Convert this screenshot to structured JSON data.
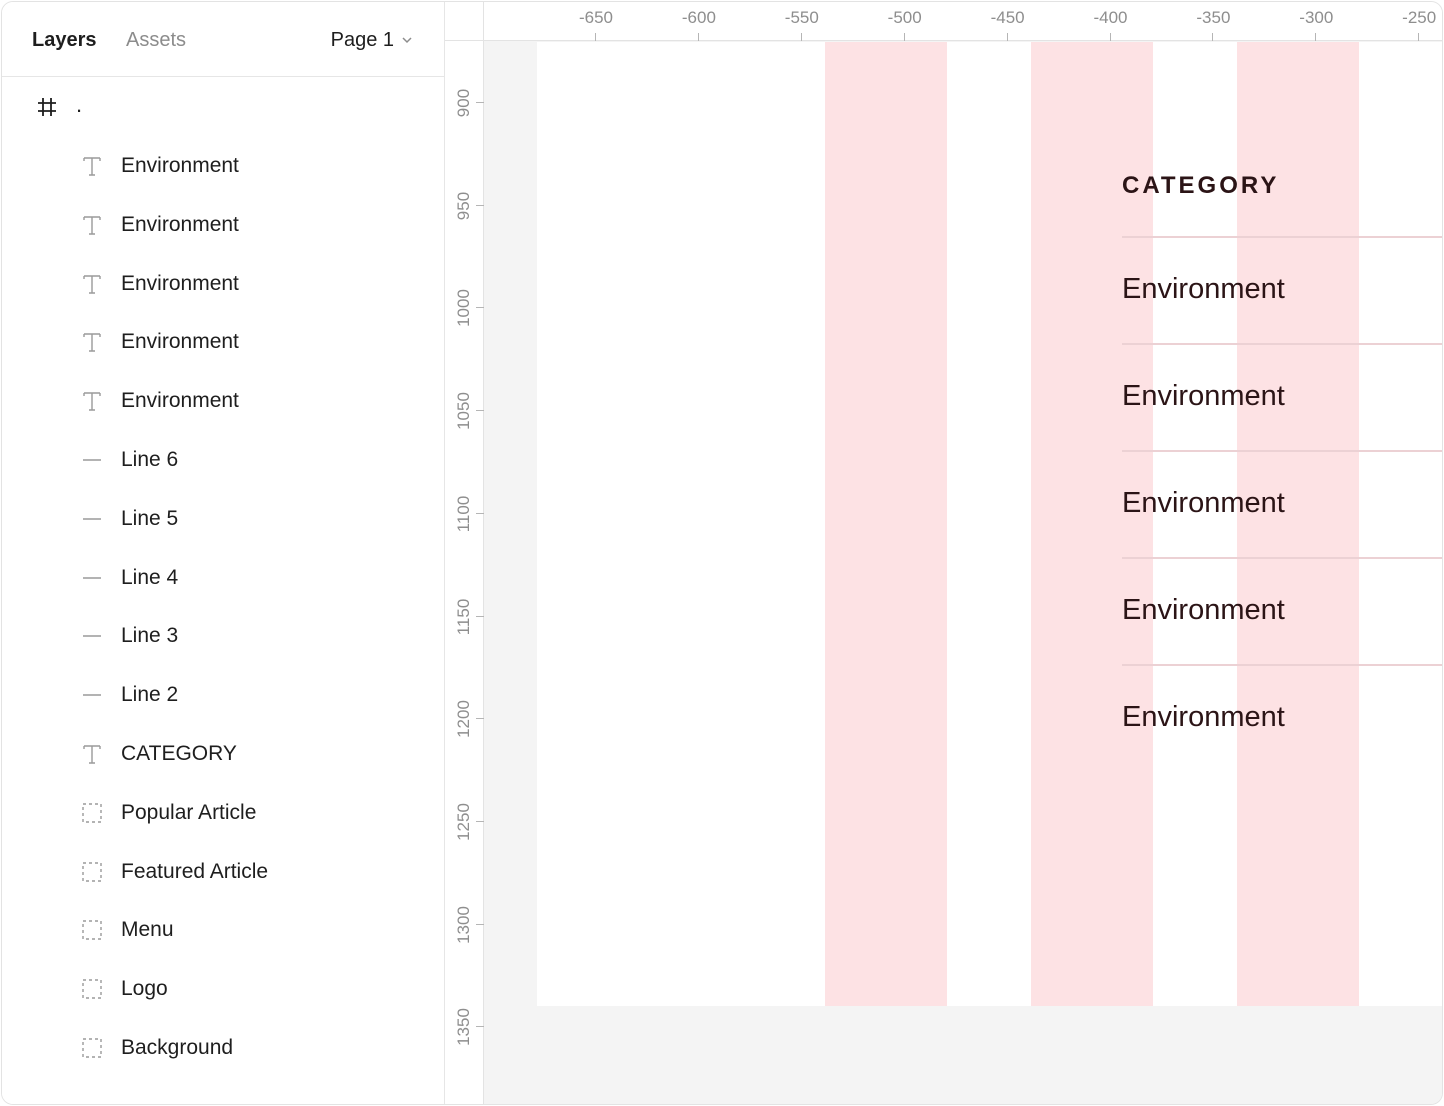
{
  "sidebar": {
    "tabs": {
      "layers": "Layers",
      "assets": "Assets"
    },
    "page": "Page 1",
    "frame": {
      "name": ".",
      "icon": "frame-hash-icon"
    },
    "layers": [
      {
        "label": "Environment",
        "icon": "text-icon"
      },
      {
        "label": "Environment",
        "icon": "text-icon"
      },
      {
        "label": "Environment",
        "icon": "text-icon"
      },
      {
        "label": "Environment",
        "icon": "text-icon"
      },
      {
        "label": "Environment",
        "icon": "text-icon"
      },
      {
        "label": "Line 6",
        "icon": "line-icon"
      },
      {
        "label": "Line 5",
        "icon": "line-icon"
      },
      {
        "label": "Line 4",
        "icon": "line-icon"
      },
      {
        "label": "Line 3",
        "icon": "line-icon"
      },
      {
        "label": "Line 2",
        "icon": "line-icon"
      },
      {
        "label": "CATEGORY",
        "icon": "text-icon"
      },
      {
        "label": "Popular Article",
        "icon": "group-icon"
      },
      {
        "label": "Featured Article",
        "icon": "group-icon"
      },
      {
        "label": "Menu",
        "icon": "group-icon"
      },
      {
        "label": "Logo",
        "icon": "group-icon"
      },
      {
        "label": "Background",
        "icon": "group-icon"
      }
    ]
  },
  "rulers": {
    "horizontal": [
      "-650",
      "-600",
      "-550",
      "-500",
      "-450",
      "-400",
      "-350",
      "-300",
      "-250"
    ],
    "vertical": [
      "900",
      "950",
      "1000",
      "1050",
      "1100",
      "1150",
      "1200",
      "1250",
      "1300",
      "1350"
    ]
  },
  "canvas": {
    "category": "CATEGORY",
    "items": [
      "Environment",
      "Environment",
      "Environment",
      "Environment",
      "Environment"
    ]
  },
  "colors": {
    "grid_column": "#fde2e4",
    "text_dark": "#2b1416",
    "divider": "#ecd1d4"
  }
}
